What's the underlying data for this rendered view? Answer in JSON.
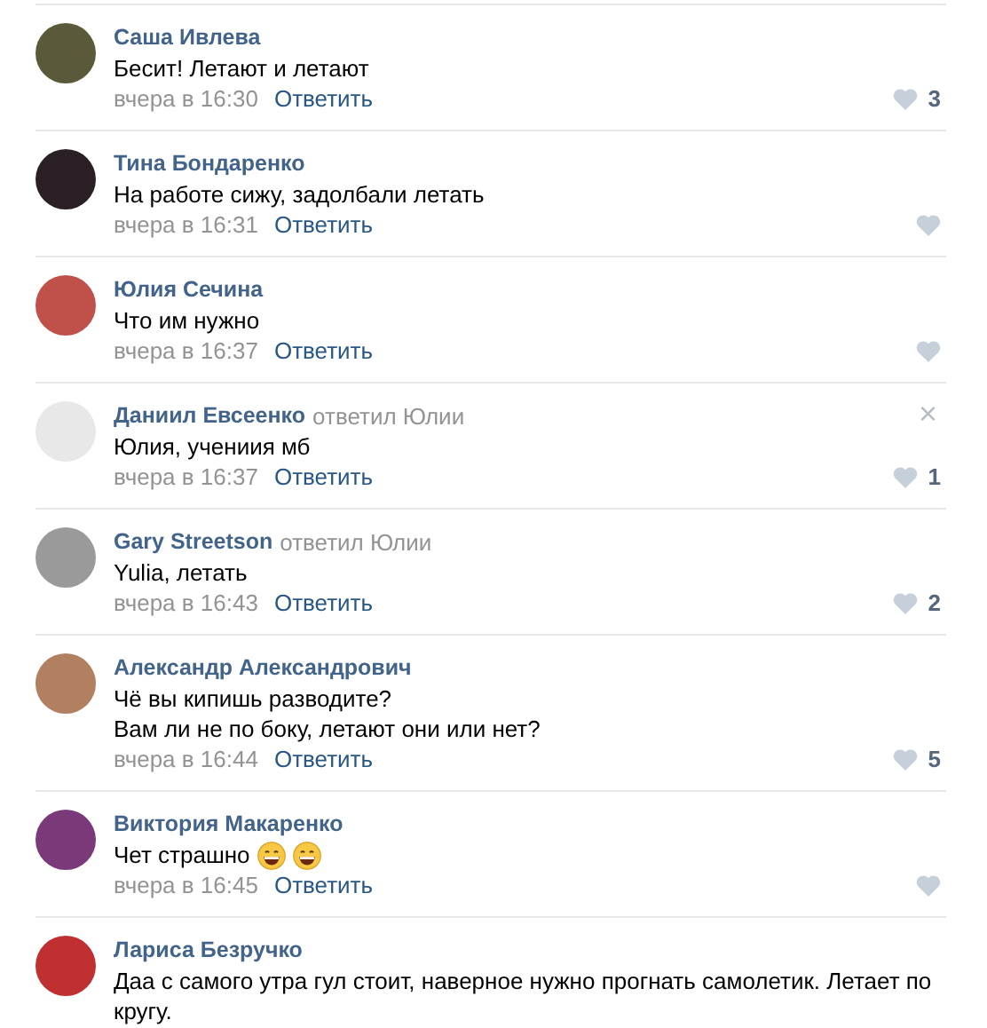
{
  "comments": [
    {
      "author": "Саша Ивлева",
      "text": "Бесит! Летают и летают",
      "time": "вчера в 16:30",
      "reply": "Ответить",
      "likes": "3"
    },
    {
      "author": "Тина Бондаренко",
      "text": "На работе сижу, задолбали летать",
      "time": "вчера в 16:31",
      "reply": "Ответить"
    },
    {
      "author": "Юлия Сечина",
      "text": "Что им нужно",
      "time": "вчера в 16:37",
      "reply": "Ответить"
    },
    {
      "author": "Даниил Евсеенко",
      "replied_to": "ответил Юлии",
      "text": "Юлия, учениия мб",
      "time": "вчера в 16:37",
      "reply": "Ответить",
      "likes": "1",
      "close": "×"
    },
    {
      "author": "Gary Streetson",
      "replied_to": "ответил Юлии",
      "text": "Yulia, летать",
      "time": "вчера в 16:43",
      "reply": "Ответить",
      "likes": "2"
    },
    {
      "author": "Александр Александрович",
      "text": "Чё вы кипишь разводите?\nВам ли не по боку, летают они или нет?",
      "time": "вчера в 16:44",
      "reply": "Ответить",
      "likes": "5"
    },
    {
      "author": "Виктория Макаренко",
      "text": "Чет страшно",
      "emojis": [
        {
          "kind": "grin"
        },
        {
          "kind": "grin"
        }
      ],
      "time": "вчера в 16:45",
      "reply": "Ответить"
    },
    {
      "author": "Лариса Безручко",
      "text": "Даа с самого утра гул стоит, наверное нужно прогнать самолетик. Летает по кругу."
    }
  ]
}
